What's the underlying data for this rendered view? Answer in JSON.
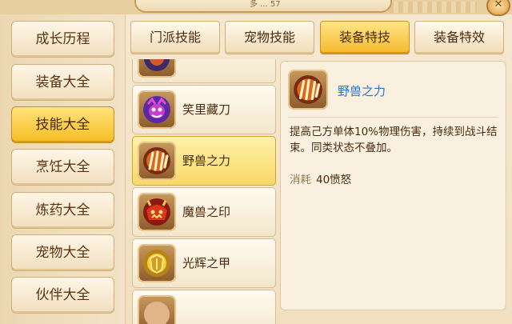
{
  "window": {
    "title_partial": "多 ... 57",
    "close_symbol": "✕"
  },
  "sidebar": {
    "items": [
      {
        "label": "成长历程",
        "active": false
      },
      {
        "label": "装备大全",
        "active": false
      },
      {
        "label": "技能大全",
        "active": true
      },
      {
        "label": "烹饪大全",
        "active": false
      },
      {
        "label": "炼药大全",
        "active": false
      },
      {
        "label": "宠物大全",
        "active": false
      },
      {
        "label": "伙伴大全",
        "active": false
      }
    ]
  },
  "tabs": [
    {
      "label": "门派技能",
      "active": false
    },
    {
      "label": "宠物技能",
      "active": false
    },
    {
      "label": "装备特技",
      "active": true
    },
    {
      "label": "装备特效",
      "active": false
    }
  ],
  "skills": [
    {
      "label": "",
      "icon": "partial-skill-icon",
      "active": false
    },
    {
      "label": "笑里藏刀",
      "icon": "purple-demon-icon",
      "active": false
    },
    {
      "label": "野兽之力",
      "icon": "beast-claw-icon",
      "active": true
    },
    {
      "label": "魔兽之印",
      "icon": "red-beast-seal-icon",
      "active": false
    },
    {
      "label": "光辉之甲",
      "icon": "golden-armor-icon",
      "active": false
    },
    {
      "label": "",
      "icon": "partial-skill-icon",
      "active": false
    }
  ],
  "detail": {
    "name": "野兽之力",
    "icon": "beast-claw-icon",
    "description": "提高己方单体10%物理伤害，持续到战斗结束。同类状态不叠加。",
    "cost_label": "消耗",
    "cost_value": "40愤怒"
  },
  "colors": {
    "accent_gold": "#f6bd26",
    "panel_bg": "#f9f0df",
    "name_blue": "#2f73c9",
    "text_brown": "#4a2b10"
  }
}
